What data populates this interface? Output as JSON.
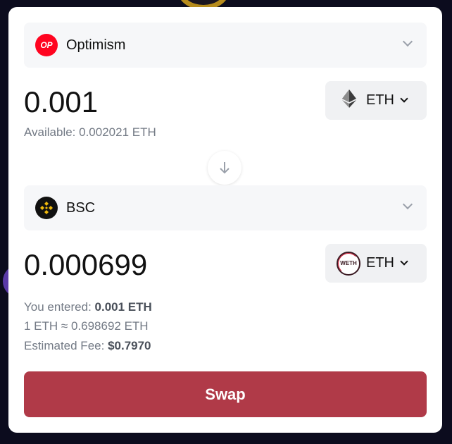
{
  "from": {
    "chain": {
      "name": "Optimism",
      "icon": "optimism-icon",
      "icon_text": "OP",
      "color": "#ff0420"
    },
    "amount": "0.001",
    "token": {
      "symbol": "ETH",
      "icon": "ethereum-icon"
    },
    "available": "Available: 0.002021 ETH"
  },
  "to": {
    "chain": {
      "name": "BSC",
      "icon": "bsc-icon",
      "color": "#f0b90b"
    },
    "amount": "0.000699",
    "token": {
      "symbol": "ETH",
      "icon": "weth-icon",
      "icon_text": "WETH"
    }
  },
  "details": {
    "entered_label": "You entered:",
    "entered_value": "0.001 ETH",
    "rate": "1 ETH ≈ 0.698692 ETH",
    "fee_label": "Estimated Fee:",
    "fee_value": "$0.7970"
  },
  "swap_button": {
    "label": "Swap",
    "color": "#b03a48"
  }
}
